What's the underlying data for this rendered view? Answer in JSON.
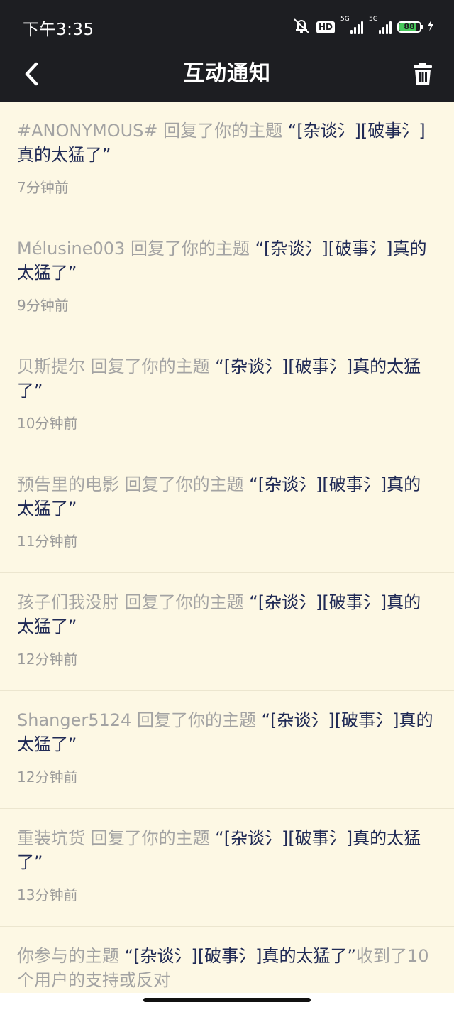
{
  "status_bar": {
    "time": "下午3:35",
    "hd_label": "HD",
    "network_1": "5G",
    "network_2": "5G",
    "battery": "88",
    "battery_level": 0.88,
    "battery_color": "#47c85a"
  },
  "header": {
    "title": "互动通知",
    "back_icon": "chevron-left-icon",
    "trash_icon": "trash-icon",
    "background": "#1d1e22"
  },
  "notifications": [
    {
      "actor": "#ANONYMOUS#",
      "action": " 回复了你的主题 ",
      "topic": "“[杂谈氵][破事氵]真的太猛了”",
      "time": "7分钟前"
    },
    {
      "actor": "Mélusine003",
      "action": " 回复了你的主题 ",
      "topic": "“[杂谈氵][破事氵]真的太猛了”",
      "time": "9分钟前"
    },
    {
      "actor": "贝斯提尔",
      "action": " 回复了你的主题 ",
      "topic": "“[杂谈氵][破事氵]真的太猛了”",
      "time": "10分钟前"
    },
    {
      "actor": "预告里的电影",
      "action": " 回复了你的主题 ",
      "topic": "“[杂谈氵][破事氵]真的太猛了”",
      "time": "11分钟前"
    },
    {
      "actor": "孩子们我没肘",
      "action": " 回复了你的主题 ",
      "topic": "“[杂谈氵][破事氵]真的太猛了”",
      "time": "12分钟前"
    },
    {
      "actor": "Shanger5124",
      "action": " 回复了你的主题 ",
      "topic": "“[杂谈氵][破事氵]真的太猛了”",
      "time": "12分钟前"
    },
    {
      "actor": "重装坑货",
      "action": " 回复了你的主题 ",
      "topic": "“[杂谈氵][破事氵]真的太猛了”",
      "time": "13分钟前"
    },
    {
      "actor": "你参与的主题 ",
      "action": "",
      "topic": "“[杂谈氵][破事氵]真的太猛了”",
      "suffix": "收到了10个用户的支持或反对",
      "time": ""
    }
  ],
  "colors": {
    "page_background": "#fdf8e4",
    "topic_text": "#202a55",
    "muted_text": "#a3a3a3"
  }
}
